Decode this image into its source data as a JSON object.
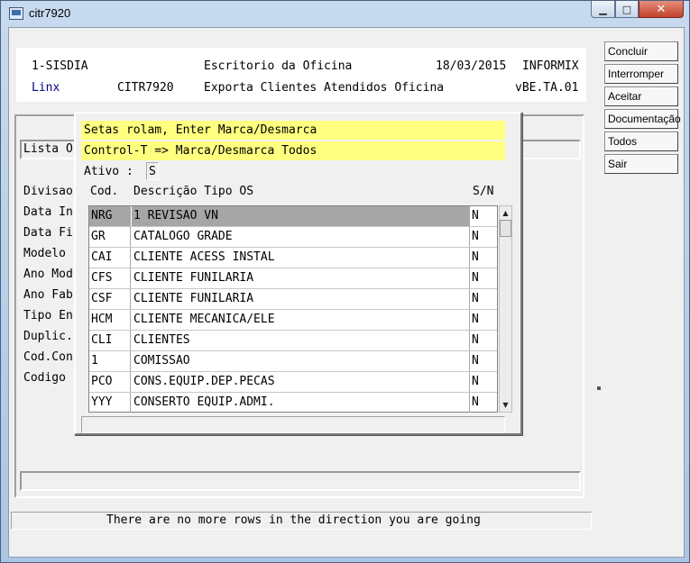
{
  "window": {
    "title": "citr7920",
    "min_glyph": "▁",
    "max_glyph": "□",
    "close_glyph": "✕"
  },
  "header": {
    "line1": {
      "system": "1-SISDIA",
      "title": "Escritorio da Oficina",
      "date": "18/03/2015",
      "db": "INFORMIX"
    },
    "line2": {
      "company": "Linx",
      "program": "CITR7920",
      "subtitle": "Exporta Clientes Atendidos Oficina",
      "version": "vBE.TA.01"
    },
    "company_color": "#000080"
  },
  "form": {
    "lista_label": "Lista O",
    "labels": [
      "Divisao",
      "Data In",
      "Data Fi",
      "Modelo",
      "Ano Mod",
      "Ano Fab",
      "Tipo En",
      "Duplic.",
      "Cod.Con",
      "Codigo"
    ]
  },
  "status_message": "There are no more rows in the direction you are going",
  "side_buttons": [
    "Concluir",
    "Interromper",
    "Aceitar",
    "Documentação",
    "Todos",
    "Sair"
  ],
  "popup": {
    "hint1": "Setas rolam, Enter Marca/Desmarca",
    "hint2": "Control-T => Marca/Desmarca Todos",
    "hint_color": "#ffff80",
    "ativo_label": "Ativo :",
    "ativo_value": "S",
    "columns": {
      "code": "Cod.",
      "desc": "Descrição Tipo OS",
      "sn": "S/N"
    },
    "rows": [
      {
        "code": "NRG",
        "desc": "1 REVISAO VN",
        "sn": "N"
      },
      {
        "code": "GR",
        "desc": "CATALOGO GRADE",
        "sn": "N"
      },
      {
        "code": "CAI",
        "desc": "CLIENTE ACESS INSTAL",
        "sn": "N"
      },
      {
        "code": "CFS",
        "desc": "CLIENTE FUNILARIA",
        "sn": "N"
      },
      {
        "code": "CSF",
        "desc": "CLIENTE FUNILARIA",
        "sn": "N"
      },
      {
        "code": "HCM",
        "desc": "CLIENTE MECANICA/ELE",
        "sn": "N"
      },
      {
        "code": "CLI",
        "desc": "CLIENTES",
        "sn": "N"
      },
      {
        "code": "1",
        "desc": "COMISSAO",
        "sn": "N"
      },
      {
        "code": "PCO",
        "desc": "CONS.EQUIP.DEP.PECAS",
        "sn": "N"
      },
      {
        "code": "YYY",
        "desc": "CONSERTO EQUIP.ADMI.",
        "sn": "N"
      }
    ],
    "scroll_up_glyph": "▲",
    "scroll_down_glyph": "▼"
  }
}
